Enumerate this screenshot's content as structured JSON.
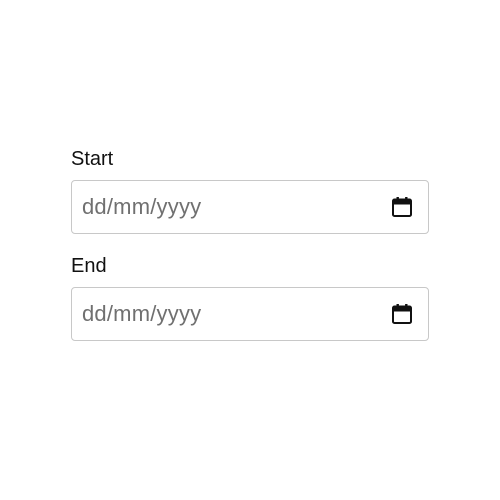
{
  "form": {
    "start": {
      "label": "Start",
      "placeholder": "dd/mm/yyyy",
      "icon": "calendar-icon"
    },
    "end": {
      "label": "End",
      "placeholder": "dd/mm/yyyy",
      "icon": "calendar-icon"
    }
  },
  "colors": {
    "label_text": "#111111",
    "placeholder_text": "#707070",
    "input_border": "#c8c8c8",
    "icon": "#111111"
  }
}
